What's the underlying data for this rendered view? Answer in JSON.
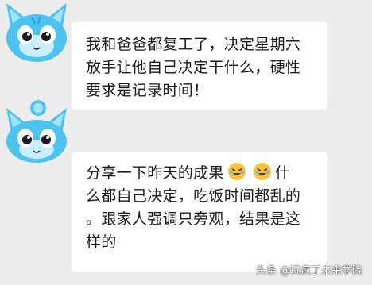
{
  "messages": [
    {
      "lines": [
        "我和爸爸都复工了，决定星期六",
        "放手让他自己决定干什么，硬性",
        "要求是记录时间！"
      ]
    },
    {
      "line1_prefix": "分享一下昨天的成果",
      "line1_suffix": "什",
      "emoji_names": [
        "rolling-on-floor-laughing-icon",
        "rolling-on-floor-laughing-icon"
      ],
      "lines_rest": [
        "么都自己决定，吃饭时间都乱的",
        "。跟家人强调只旁观，结果是这",
        "样的"
      ]
    }
  ],
  "watermark": "头条 @玩疯了未来学院",
  "colors": {
    "background": "#ededed",
    "bubble": "#ffffff",
    "avatar_blue": "#4fc3f0",
    "emoji_yellow": "#f9c23c"
  }
}
